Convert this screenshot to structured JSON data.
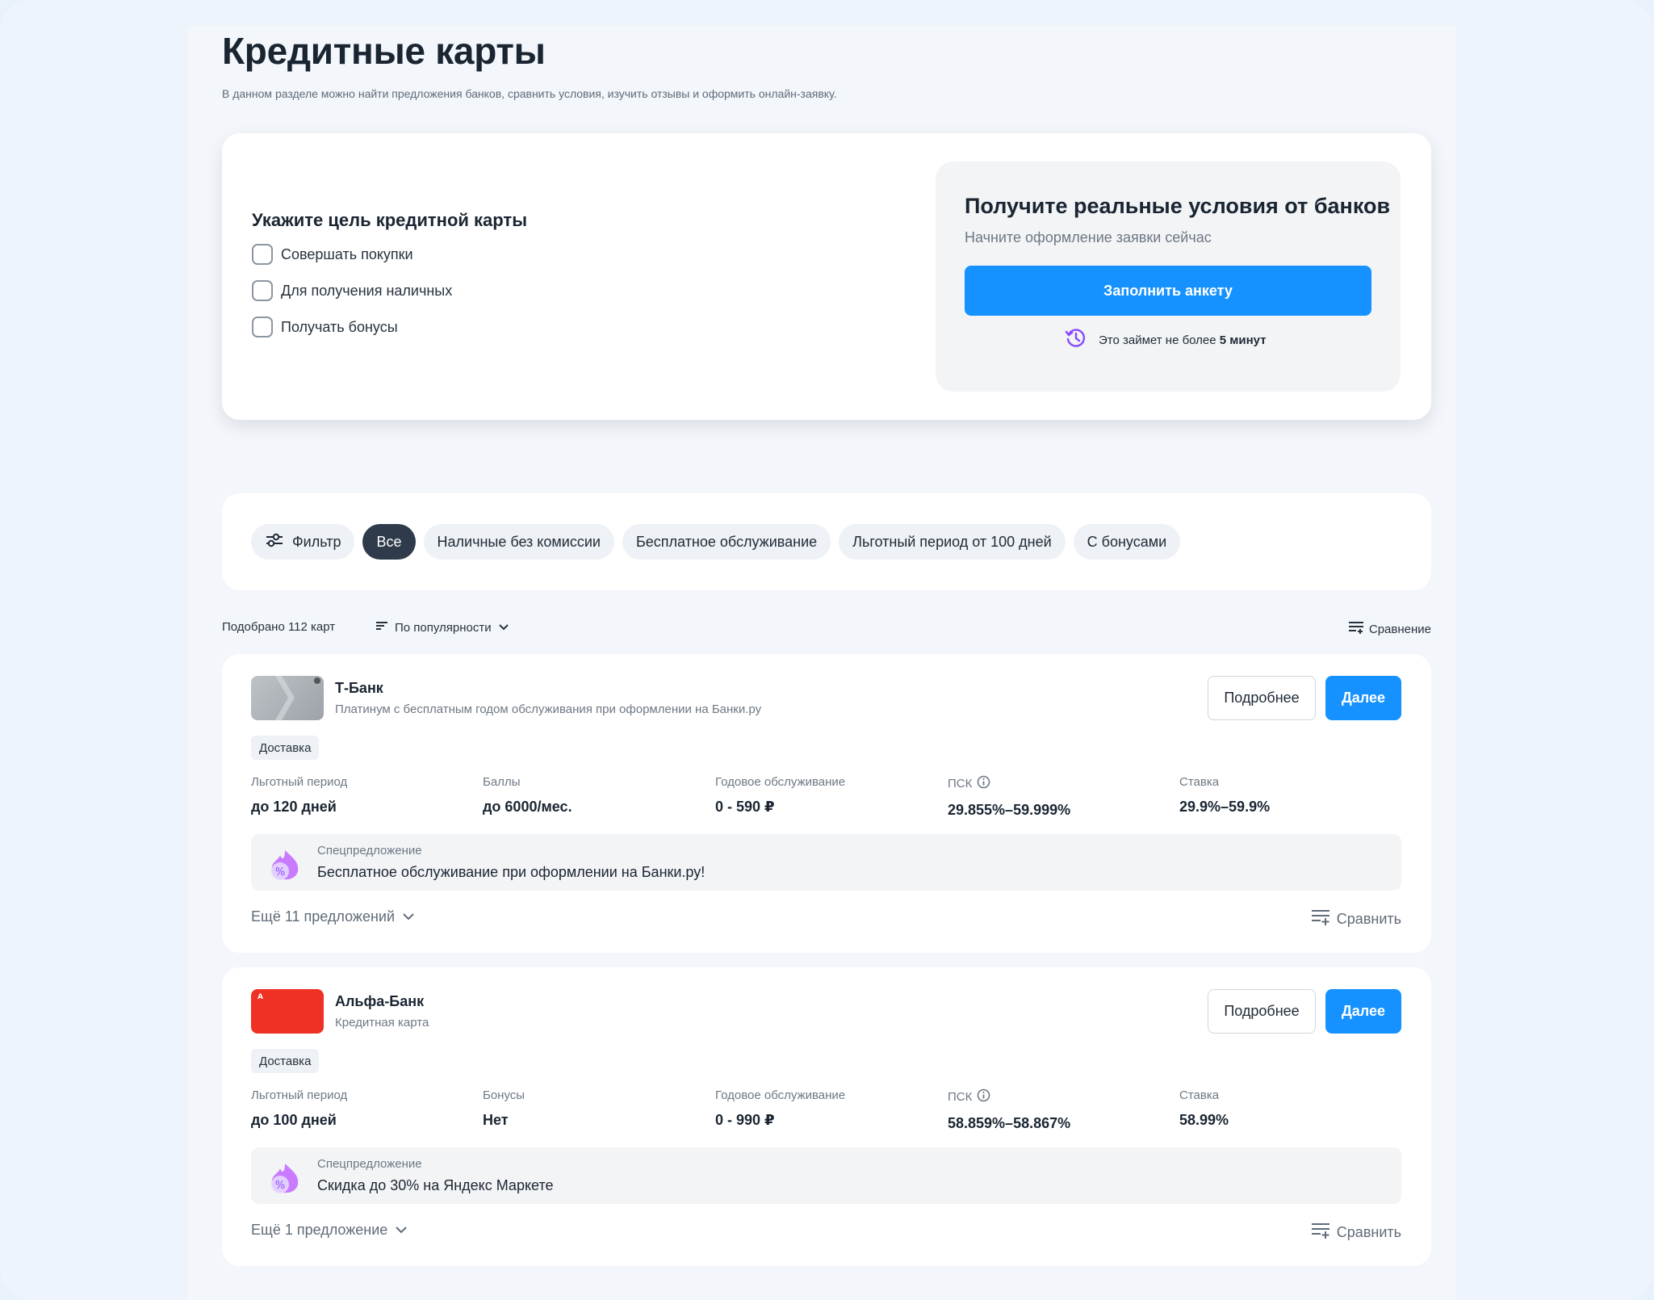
{
  "header": {
    "title": "Кредитные карты",
    "subtitle": "В данном разделе можно найти предложения банков, сравнить условия, изучить отзывы и оформить онлайн-заявку."
  },
  "goal": {
    "title": "Укажите цель кредитной карты",
    "options": [
      "Совершать покупки",
      "Для получения наличных",
      "Получать бонусы"
    ]
  },
  "cta": {
    "title": "Получите реальные условия от банков",
    "subtitle": "Начните оформление заявки сейчас",
    "button": "Заполнить анкету",
    "note_prefix": "Это займет не более",
    "note_bold": "5 минут"
  },
  "filters": {
    "filter_label": "Фильтр",
    "chips": [
      "Все",
      "Наличные без комиссии",
      "Бесплатное обслуживание",
      "Льготный период от 100 дней",
      "С бонусами"
    ]
  },
  "list_meta": {
    "found": "Подобрано 112 карт",
    "sort": "По популярности",
    "compare": "Сравнение"
  },
  "cards": [
    {
      "bank": "Т-Банк",
      "desc": "Платинум с бесплатным годом обслуживания при оформлении на Банки.ру",
      "tag": "Доставка",
      "more_btn": "Подробнее",
      "next_btn": "Далее",
      "stats": [
        {
          "label": "Льготный период",
          "value": "до 120 дней"
        },
        {
          "label": "Баллы",
          "value": "до 6000/мес."
        },
        {
          "label": "Годовое обслуживание",
          "value": "0 - 590 ₽"
        },
        {
          "label": "ПСК",
          "value": "29.855%–59.999%"
        },
        {
          "label": "Ставка",
          "value": "29.9%–59.9%"
        }
      ],
      "special_label": "Спецпредложение",
      "special_text": "Бесплатное обслуживание при оформлении на Банки.ру!",
      "more_offers": "Ещё 11 предложений",
      "compare": "Сравнить"
    },
    {
      "bank": "Альфа-Банк",
      "desc": "Кредитная карта",
      "tag": "Доставка",
      "more_btn": "Подробнее",
      "next_btn": "Далее",
      "stats": [
        {
          "label": "Льготный период",
          "value": "до 100 дней"
        },
        {
          "label": "Бонусы",
          "value": "Нет"
        },
        {
          "label": "Годовое обслуживание",
          "value": "0 - 990 ₽"
        },
        {
          "label": "ПСК",
          "value": "58.859%–58.867%"
        },
        {
          "label": "Ставка",
          "value": "58.99%"
        }
      ],
      "special_label": "Спецпредложение",
      "special_text": "Скидка до 30% на Яндекс Маркете",
      "more_offers": "Ещё 1 предложение",
      "compare": "Сравнить"
    }
  ],
  "colors": {
    "accent": "#1592ff",
    "chip_active": "#2f3b4b",
    "alfa_red": "#ef3124",
    "cta_clock": "#8a4dff"
  }
}
